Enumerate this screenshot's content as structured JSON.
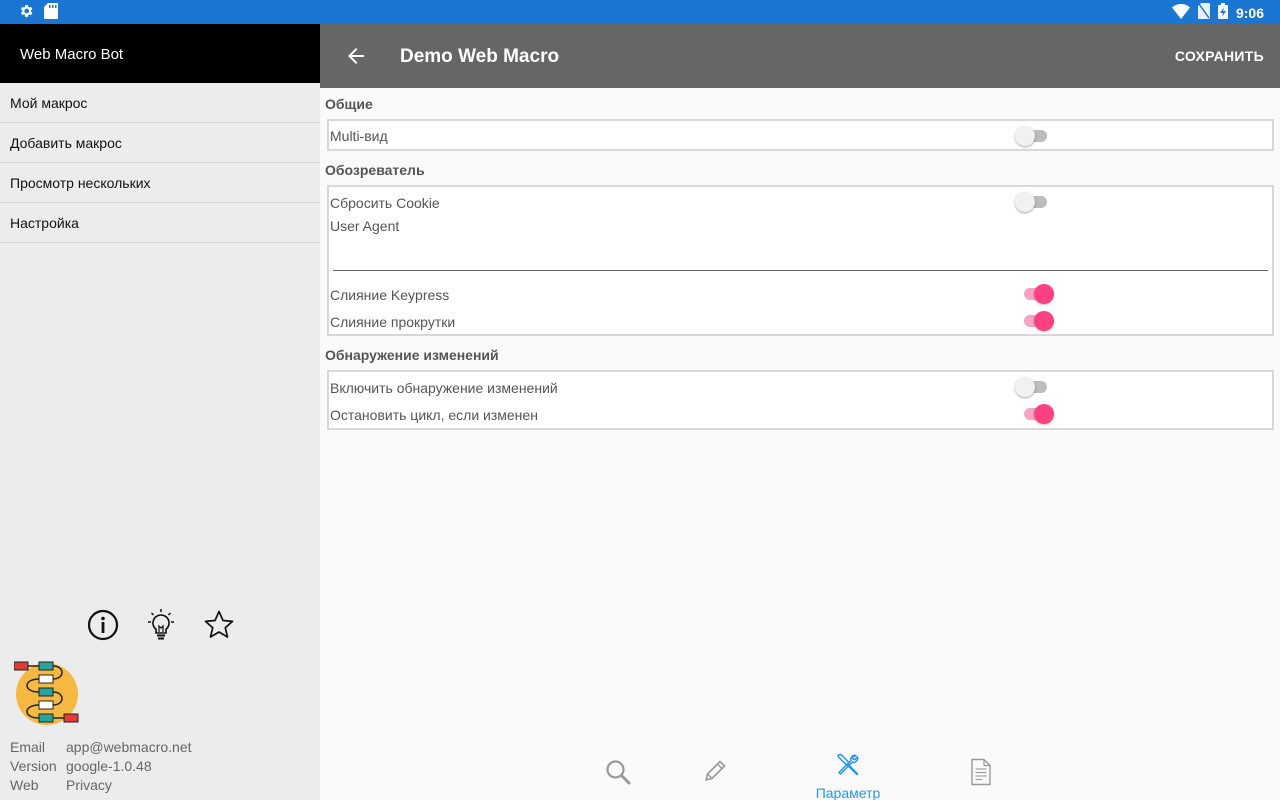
{
  "statusbar": {
    "time": "9:06"
  },
  "drawer": {
    "header_title": "Web Macro Bot",
    "items": [
      {
        "label": "Мой макрос"
      },
      {
        "label": "Добавить макрос"
      },
      {
        "label": "Просмотр нескольких"
      },
      {
        "label": "Настройка"
      }
    ],
    "icons": [
      "info-icon",
      "lightbulb-icon",
      "star-icon"
    ],
    "info": [
      {
        "key": "Email",
        "value": "app@webmacro.net"
      },
      {
        "key": "Version",
        "value": "google-1.0.48"
      },
      {
        "key": "Web",
        "value": "Privacy"
      }
    ]
  },
  "toolbar": {
    "title": "Demo Web Macro",
    "save_label": "СОХРАНИТЬ"
  },
  "sections": {
    "general": {
      "title": "Общие",
      "multi_view": {
        "label": "Multi-вид",
        "on": false
      }
    },
    "browser": {
      "title": "Обозреватель",
      "reset_cookie": {
        "label": "Сбросить Cookie",
        "on": false
      },
      "user_agent": {
        "label": "User Agent",
        "value": ""
      },
      "merge_keypress": {
        "label": "Слияние Keypress",
        "on": true
      },
      "merge_scroll": {
        "label": "Слияние прокрутки",
        "on": true
      }
    },
    "change_detection": {
      "title": "Обнаружение изменений",
      "enable": {
        "label": "Включить обнаружение изменений",
        "on": false
      },
      "stop_loop": {
        "label": "Остановить цикл, если изменен",
        "on": true
      }
    }
  },
  "bottom_nav": {
    "items": [
      {
        "icon": "search-icon",
        "label": ""
      },
      {
        "icon": "pencil-icon",
        "label": ""
      },
      {
        "icon": "tools-icon",
        "label": "Параметр",
        "active": true
      },
      {
        "icon": "document-icon",
        "label": ""
      }
    ]
  },
  "colors": {
    "statusbar": "#1976d2",
    "toolbar": "#666666",
    "accent": "#ff4081",
    "active_tab": "#2196f3"
  }
}
